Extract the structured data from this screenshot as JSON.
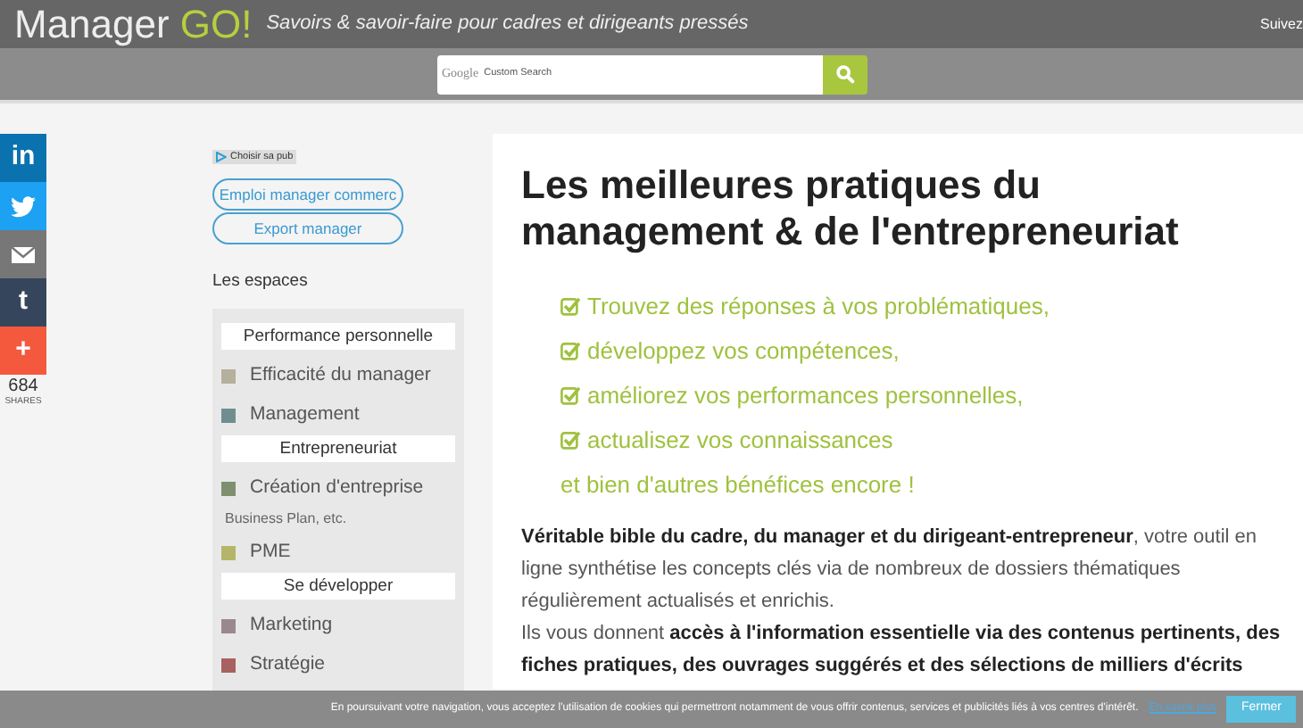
{
  "header": {
    "logo_main": "Manager",
    "logo_accent": "GO!",
    "tagline": "Savoirs & savoir-faire pour cadres et dirigeants pressés",
    "follow": "Suivez"
  },
  "search": {
    "brand": "Google",
    "placeholder": "Custom Search"
  },
  "share": {
    "buttons": [
      {
        "kind": "linkedin",
        "label": "in"
      },
      {
        "kind": "twitter"
      },
      {
        "kind": "email"
      },
      {
        "kind": "tumblr",
        "label": "t"
      },
      {
        "kind": "more",
        "label": "+"
      }
    ],
    "count": "684",
    "count_label": "SHARES"
  },
  "sidebar": {
    "ad_label": "Choisir sa pub",
    "links": [
      "Emploi manager commerc",
      "Export manager"
    ],
    "title": "Les espaces",
    "items": [
      {
        "kind": "heading",
        "label": "Performance personnelle"
      },
      {
        "kind": "item",
        "label": "Efficacité du manager",
        "color": "#b5b09c"
      },
      {
        "kind": "item",
        "label": "Management",
        "color": "#6f8f8f"
      },
      {
        "kind": "heading",
        "label": "Entrepreneuriat"
      },
      {
        "kind": "item",
        "label": "Création d'entreprise",
        "color": "#7f8f70"
      },
      {
        "kind": "note",
        "label": "Business Plan, etc."
      },
      {
        "kind": "item",
        "label": "PME",
        "color": "#b5b56a"
      },
      {
        "kind": "heading",
        "label": "Se développer"
      },
      {
        "kind": "item",
        "label": "Marketing",
        "color": "#9a8890"
      },
      {
        "kind": "item",
        "label": "Stratégie",
        "color": "#a86060"
      }
    ]
  },
  "main": {
    "title": "Les meilleures pratiques du management & de l'entrepreneuriat",
    "benefits": [
      "Trouvez des réponses à vos problématiques,",
      "développez vos compétences,",
      "améliorez vos performances personnelles,",
      "actualisez vos connaissances"
    ],
    "benefits_end": "et bien d'autres bénéfices encore !",
    "paragraphs": [
      "**Véritable bible du cadre, du manager et du dirigeant-entrepreneur**, votre outil en ligne synthétise les concepts clés via de nombreux de dossiers thématiques régulièrement actualisés et enrichis.",
      "Ils vous donnent **accès à l'information essentielle via des contenus pertinents, des fiches pratiques, des ouvrages suggérés et des sélections de milliers d'écrits**"
    ]
  },
  "cookie_bar": {
    "text": "En poursuivant votre navigation, vous acceptez l'utilisation de cookies qui permettront notamment de vous offrir contenus, services et publicités liés à vos centres d'intérêt.",
    "link": "En savoir plus",
    "button": "Fermer"
  }
}
